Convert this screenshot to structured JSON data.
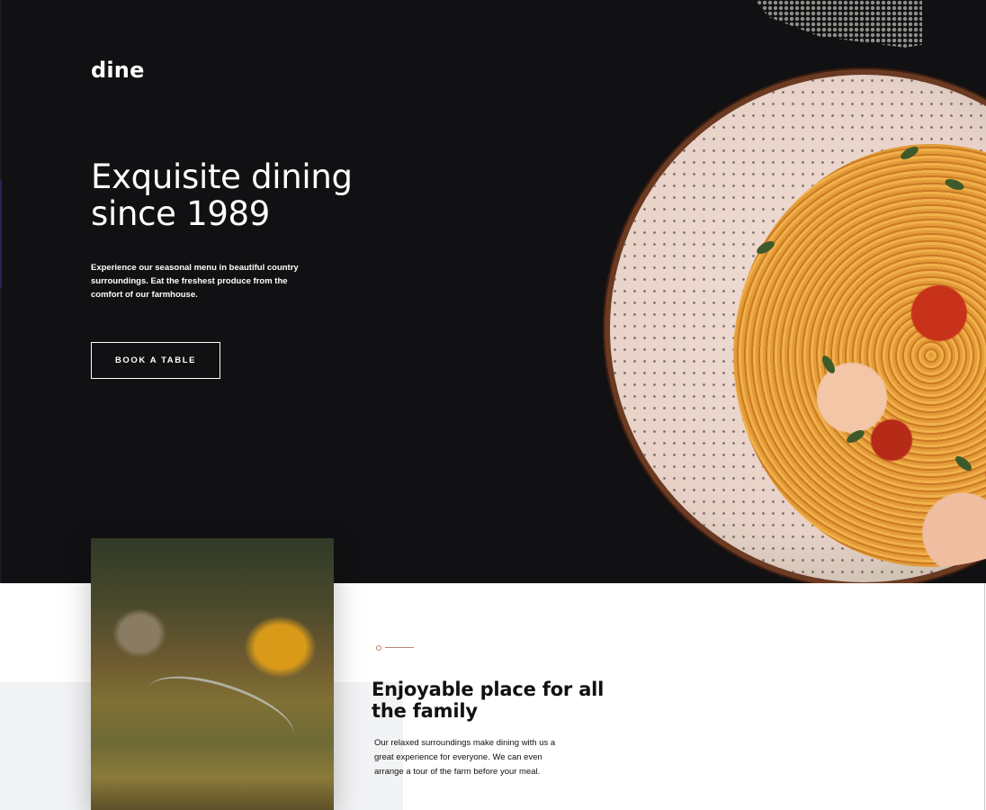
{
  "brand": {
    "logo": "dine"
  },
  "hero": {
    "title": "Exquisite dining since 1989",
    "text": "Experience our seasonal menu in beautiful country surroundings. Eat the freshest produce from the comfort of our farmhouse.",
    "cta_label": "BOOK A TABLE"
  },
  "family": {
    "title": "Enjoyable place for all the family",
    "text": "Our relaxed surroundings make dining with us a great experience for everyone. We can even arrange a tour of the farm before your meal."
  },
  "colors": {
    "hero_bg": "#111012",
    "accent": "#b8856a",
    "text_dark": "#111111",
    "band_gray": "#f2f3f5"
  }
}
